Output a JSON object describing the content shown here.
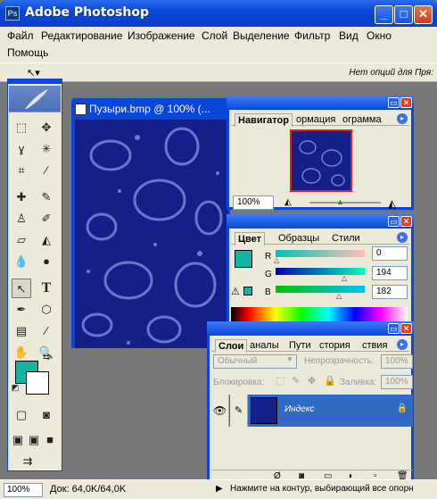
{
  "app": {
    "title": "Adobe Photoshop",
    "icon": "photoshop-icon"
  },
  "menu": [
    "Файл",
    "Редактирование",
    "Изображение",
    "Слой",
    "Выделение",
    "Фильтр",
    "Вид",
    "Окно",
    "Помощь"
  ],
  "options_hint": "Нет опций для Пря:",
  "document": {
    "title": "Пузыри.bmp @ 100% (..."
  },
  "navigator": {
    "tabs": [
      "Навигатор",
      "ормация",
      "ограмма"
    ],
    "zoom": "100%"
  },
  "color": {
    "tabs": [
      "Цвет",
      "Образцы",
      "Стили"
    ],
    "r_label": "R",
    "g_label": "G",
    "b_label": "B",
    "r": "0",
    "g": "194",
    "b": "182",
    "fg": "#16b3a2"
  },
  "layers": {
    "tabs": [
      "Слои",
      "аналы",
      "Пути",
      "стория",
      "ствия"
    ],
    "blend": "Обычный",
    "opacity_label": "Непрозрачность:",
    "opacity": "100%",
    "lock_label": "Блокировка:",
    "fill_label": "Заливка:",
    "fill": "100%",
    "layer_name": "Индекс"
  },
  "status": {
    "zoom": "100%",
    "doc": "Док: 64,0K/64,0K",
    "msg": "Нажмите на контур, выбирающий все опорн"
  },
  "colors": {
    "titlebar": "#0a46d8",
    "canvas": "#151f8a",
    "accent": "#16b3a2"
  }
}
